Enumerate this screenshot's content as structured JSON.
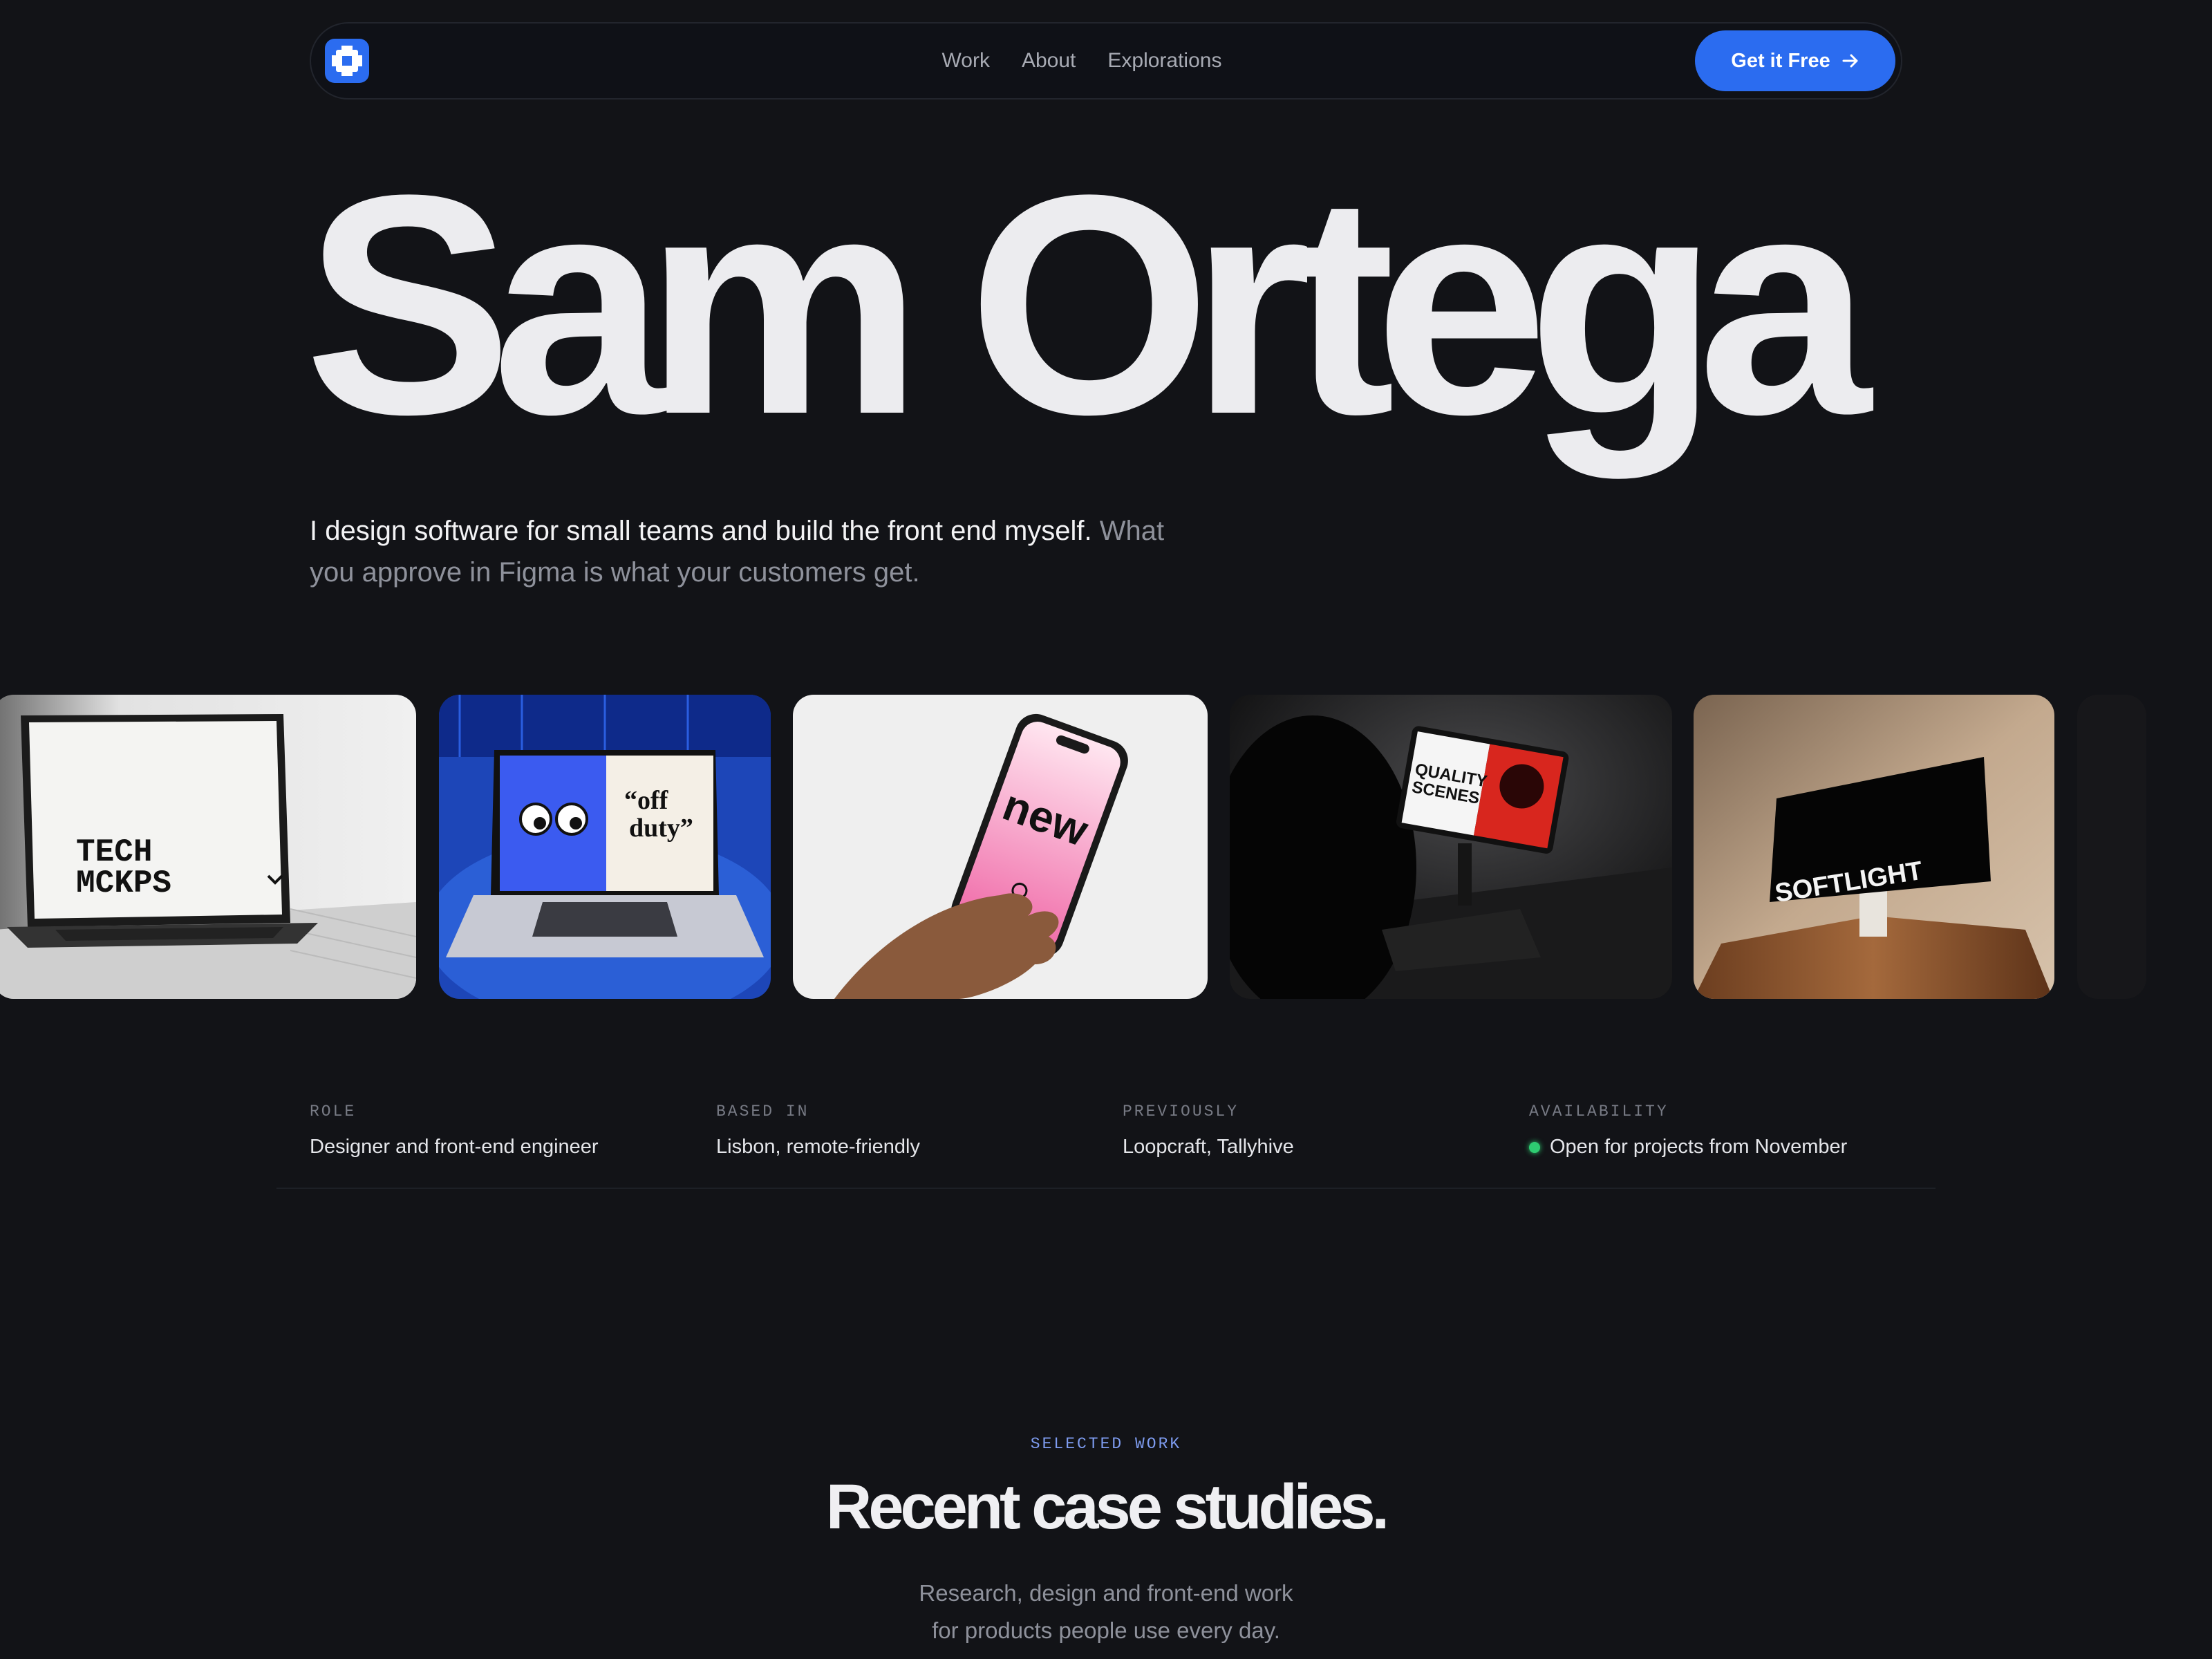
{
  "nav": {
    "links": [
      "Work",
      "About",
      "Explorations"
    ],
    "cta_label": "Get it Free"
  },
  "hero": {
    "name": "Sam Ortega",
    "intro_primary": "I design software for small teams and build the front end myself.",
    "intro_secondary": "What you approve in Figma is what your customers get."
  },
  "gallery": {
    "cards": [
      {
        "alt": "laptop mockup",
        "text": [
          "TECH",
          "MCKPS"
        ]
      },
      {
        "alt": "laptop mockup",
        "text": [
          "“off",
          "duty”"
        ]
      },
      {
        "alt": "phone mockup",
        "text": [
          "new"
        ]
      },
      {
        "alt": "tablet mockup",
        "text": [
          "QUALITY",
          "SCENES"
        ]
      },
      {
        "alt": "monitor mockup",
        "text": [
          "SOFTLIGHT"
        ]
      }
    ]
  },
  "facts": [
    {
      "label": "ROLE",
      "value": "Designer and front-end engineer"
    },
    {
      "label": "BASED IN",
      "value": "Lisbon, remote-friendly"
    },
    {
      "label": "PREVIOUSLY",
      "value": "Loopcraft, Tallyhive"
    },
    {
      "label": "AVAILABILITY",
      "value": "Open for projects from November",
      "status_color": "#2ecc71"
    }
  ],
  "section": {
    "eyebrow": "SELECTED WORK",
    "title": "Recent case studies.",
    "subtitle_line1": "Research, design and front-end work",
    "subtitle_line2": "for products people use every day."
  },
  "colors": {
    "background": "#121317",
    "accent": "#2b6cf0",
    "eyebrow": "#7e9cf0"
  }
}
